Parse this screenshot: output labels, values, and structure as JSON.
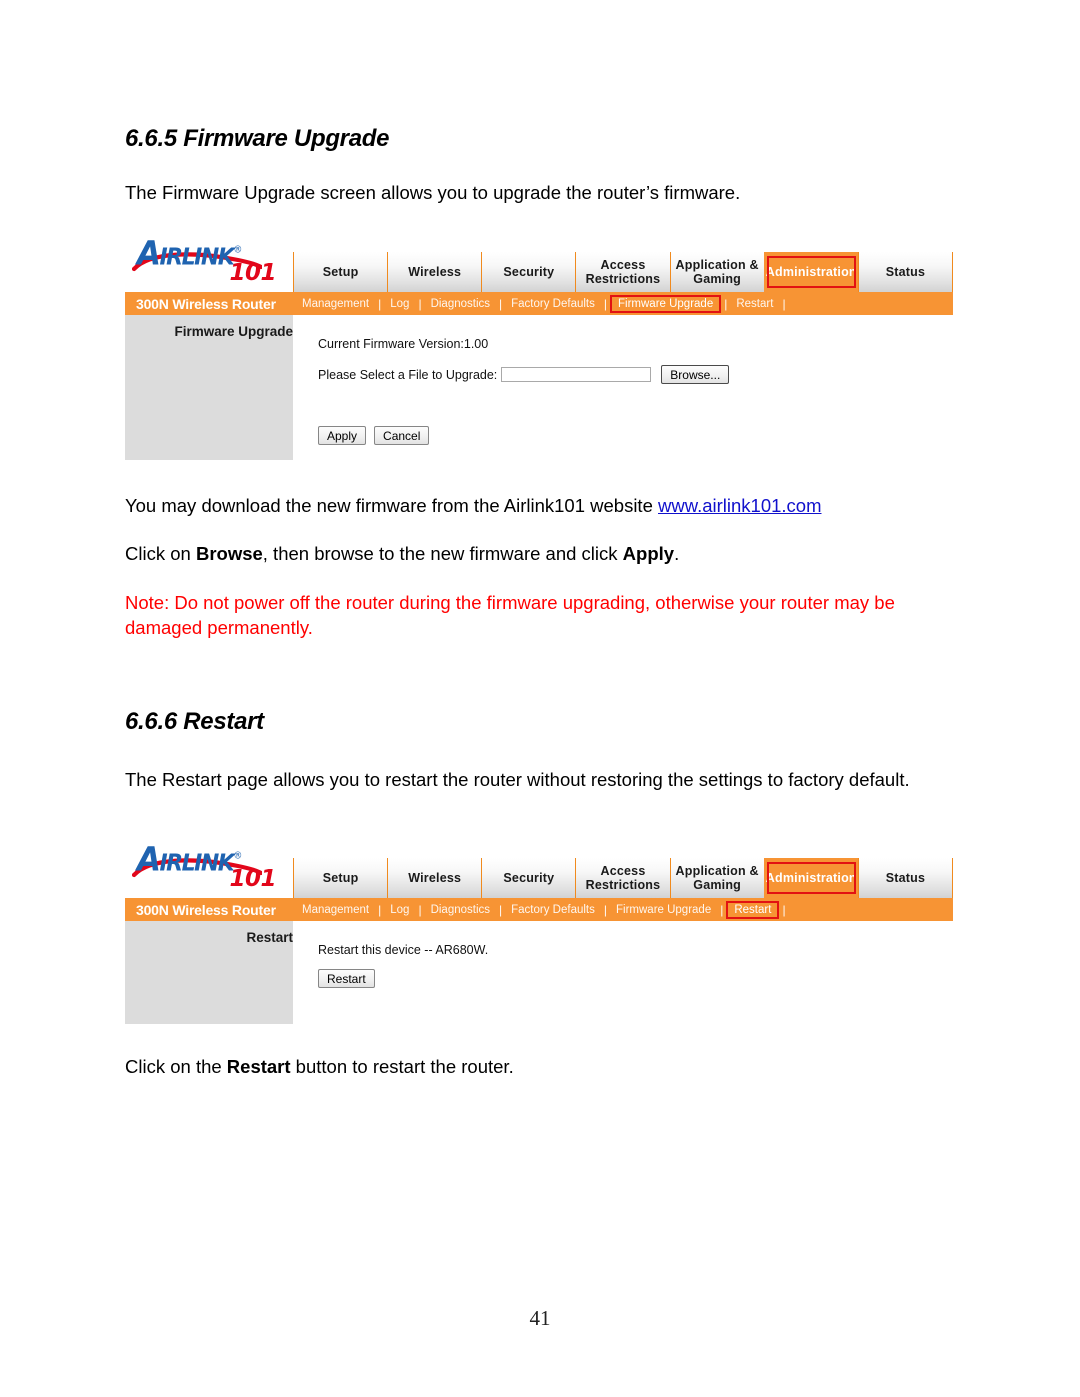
{
  "page": {
    "number": "41"
  },
  "sections": [
    {
      "heading": "6.6.5 Firmware Upgrade",
      "intro": "The Firmware Upgrade screen allows you to upgrade the router’s firmware."
    },
    {
      "heading": "6.6.6 Restart",
      "intro": "The Restart page allows you to restart the router without restoring the settings to factory default."
    }
  ],
  "paragraphs": {
    "download_prefix": "You may download the new firmware from the Airlink101 website ",
    "download_link": "www.airlink101.com",
    "browse_prefix": "Click on ",
    "browse_bold": "Browse",
    "browse_mid": ", then browse to the new firmware and click ",
    "apply_bold": "Apply",
    "browse_suffix": ".",
    "note": "Note: Do not power off the router during the firmware upgrading, otherwise your router may be damaged permanently.",
    "restart_prefix": "Click on the ",
    "restart_bold": "Restart",
    "restart_suffix": " button to restart the router."
  },
  "router_ui": {
    "logo": {
      "air": "A",
      "irlink": "IRL",
      "ink_small": "INK",
      "registered": "®",
      "number": "101"
    },
    "device_name": "300N Wireless Router",
    "tabs": [
      {
        "label": "Setup",
        "active": false
      },
      {
        "label": "Wireless",
        "active": false
      },
      {
        "label": "Security",
        "active": false
      },
      {
        "label": "Access Restrictions",
        "active": false
      },
      {
        "label": "Application & Gaming",
        "active": false
      },
      {
        "label": "Administration",
        "active": true
      },
      {
        "label": "Status",
        "active": false
      }
    ],
    "submenu": [
      {
        "label": "Management",
        "active": false
      },
      {
        "label": "Log",
        "active": false
      },
      {
        "label": "Diagnostics",
        "active": false
      },
      {
        "label": "Factory Defaults",
        "active": false
      },
      {
        "label": "Firmware Upgrade",
        "active": true
      },
      {
        "label": "Restart",
        "active": false
      }
    ],
    "submenu_restart": [
      {
        "label": "Management",
        "active": false
      },
      {
        "label": "Log",
        "active": false
      },
      {
        "label": "Diagnostics",
        "active": false
      },
      {
        "label": "Factory Defaults",
        "active": false
      },
      {
        "label": "Firmware Upgrade",
        "active": false
      },
      {
        "label": "Restart",
        "active": true
      }
    ],
    "firmware_panel": {
      "side_title": "Firmware Upgrade",
      "version_label": "Current Firmware Version:1.00",
      "file_label": "Please Select a File to Upgrade:",
      "file_value": "",
      "browse_button": "Browse...",
      "apply_button": "Apply",
      "cancel_button": "Cancel"
    },
    "restart_panel": {
      "side_title": "Restart",
      "message": "Restart this device -- AR680W.",
      "restart_button": "Restart"
    }
  },
  "colors": {
    "orange": "#f79434",
    "red_highlight": "#e21212",
    "logo_blue": "#1f63b0",
    "logo_red": "#e2061a",
    "note_red": "#ff0000",
    "link_blue": "#1111cc",
    "side_panel_gray": "#dcdcdc"
  }
}
